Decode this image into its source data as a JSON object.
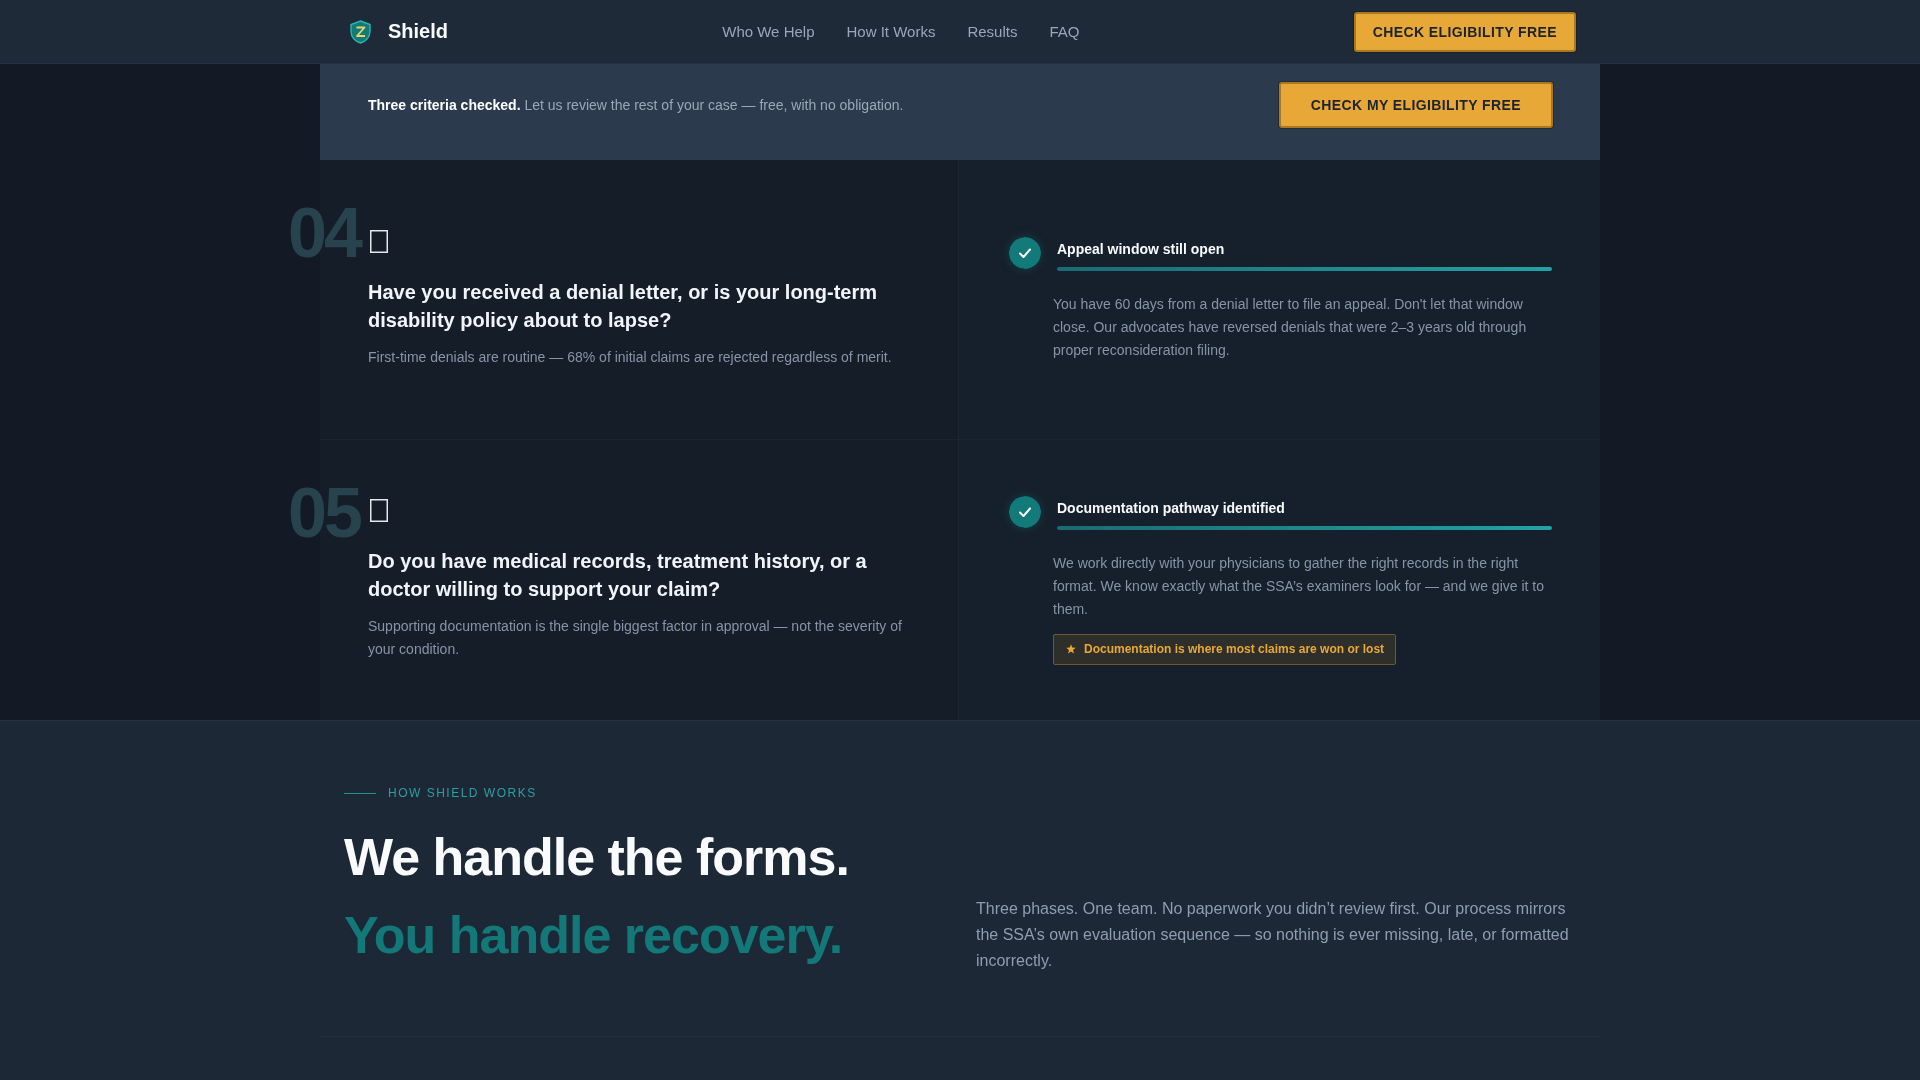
{
  "header": {
    "brand": "Shield",
    "nav": [
      {
        "label": "Who We Help"
      },
      {
        "label": "How It Works"
      },
      {
        "label": "Results"
      },
      {
        "label": "FAQ"
      }
    ],
    "cta": "CHECK ELIGIBILITY FREE"
  },
  "banner": {
    "message": "**Three criteria checked.** Let us review the rest of your case — free, with no obligation.",
    "button": "CHECK MY ELIGIBILITY FREE"
  },
  "criteria": [
    {
      "number": "04",
      "question": "Have you received a denial letter, or is your long-term disability policy about to lapse?",
      "note": "First-time denials are routine — 68% of initial claims are rejected regardless of merit.",
      "result": {
        "checked": true,
        "title": "Appeal window still open",
        "body": "You have 60 days from a denial letter to file an appeal. Don't let that window close. Our advocates have reversed denials that were 2–3 years old through proper reconsideration filing."
      }
    },
    {
      "number": "05",
      "question": "Do you have medical records, treatment history, or a doctor willing to support your claim?",
      "note": "Supporting documentation is the single biggest factor in approval — not the severity of your condition.",
      "result": {
        "checked": true,
        "title": "Documentation pathway identified",
        "body": "We work directly with your physicians to gather the right records in the right format. We know exactly what the SSA’s examiners look for — and we give it to them.",
        "tip": "Documentation is where most claims are won or lost"
      }
    }
  ],
  "how_it_works": {
    "eyebrow": "HOW SHIELD WORKS",
    "headline": "We handle the forms.",
    "headline_accent": "You handle recovery.",
    "description": "Three phases. One team. No paperwork you didn’t review first. Our process mirrors the SSA’s own evaluation sequence — so nothing is ever missing, late, or formatted incorrectly."
  }
}
